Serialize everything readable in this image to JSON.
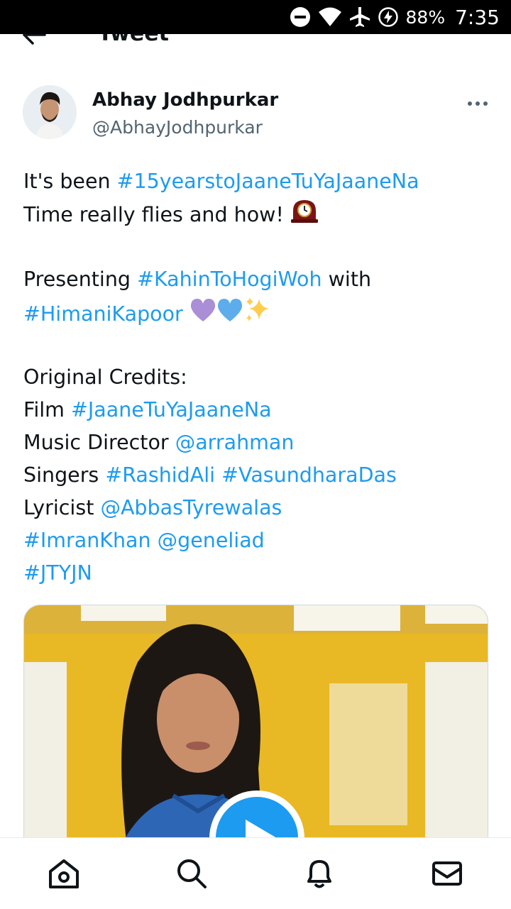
{
  "status_bar": {
    "battery": "88%",
    "time": "7:35",
    "icons": [
      "dnd-icon",
      "wifi-icon",
      "airplane-icon",
      "battery-charging-icon"
    ]
  },
  "header": {
    "title": "Tweet",
    "back_icon": "arrow-left-icon"
  },
  "tweet": {
    "author_name": "Abhay Jodhpurkar",
    "author_handle": "@AbhayJodhpurkar",
    "more_icon": "more-horizontal-icon",
    "text": {
      "l1_a": "It's been ",
      "l1_b": "#15yearstoJaaneTuYaJaaneNa",
      "l2_a": "Time really flies and how! ",
      "l4_a": "Presenting ",
      "l4_b": "#KahinToHogiWoh",
      "l4_c": " with",
      "l5_a": "#HimaniKapoor",
      "l7_a": "Original Credits:",
      "l8_a": "Film ",
      "l8_b": "#JaaneTuYaJaaneNa",
      "l9_a": "Music Director ",
      "l9_b": "@arrahman",
      "l10_a": "Singers ",
      "l10_b": "#RashidAli",
      "l10_c": " ",
      "l10_d": "#VasundharaDas",
      "l11_a": "Lyricist ",
      "l11_b": "@AbbasTyrewalas",
      "l12_a": "#ImranKhan",
      "l12_b": " ",
      "l12_c": "@geneliad",
      "l13_a": "#JTYJN"
    },
    "emojis": [
      "mantelpiece-clock-emoji",
      "purple-heart-emoji",
      "blue-heart-emoji",
      "sparkles-emoji"
    ],
    "media": {
      "type": "video",
      "play_icon": "play-icon"
    }
  },
  "bottom_nav": [
    "home-icon",
    "search-icon",
    "notifications-icon",
    "messages-icon"
  ],
  "colors": {
    "link": "#1d9bf0",
    "text": "#0f1419",
    "secondary": "#536471"
  }
}
